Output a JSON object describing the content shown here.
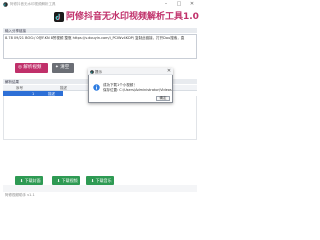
{
  "window": {
    "title": "阿修抖音无水印视频解析工具",
    "min_icon": "–",
    "max_icon": "□",
    "close_icon": "✕"
  },
  "header": {
    "title": "阿修抖音无水印视频解析工具1.0"
  },
  "url_section": {
    "label": "输入分享链接",
    "value": "8.78 09/21 BOG:/ 0@F.KN 8赞视频 整瓶 https://v.douyin.com/i_PCIWv4KDP/ 复制此链接，打开Dou搜索，直"
  },
  "buttons": {
    "parse": "◎ 解析视频",
    "clear": "✦ 清空",
    "download_cover": "⬇ 下载封面",
    "download_video": "⬇ 下载视频",
    "download_music": "⬇ 下载音乐"
  },
  "results": {
    "label": "解析结果",
    "columns": [
      "序号",
      "描述"
    ],
    "rows": [
      {
        "seq": "1",
        "desc": "描述"
      }
    ]
  },
  "footer": {
    "version": "阿修视频助手 v1.1"
  },
  "dialog": {
    "title": "提示",
    "line1": "成功下载1个小视频！",
    "line2": "保存位置: C:\\Users\\Administrator\\Videos",
    "ok": "确定"
  },
  "colors": {
    "brand": "#c0306a",
    "selection": "#2d6fd6",
    "download_green": "#2e9a53"
  }
}
